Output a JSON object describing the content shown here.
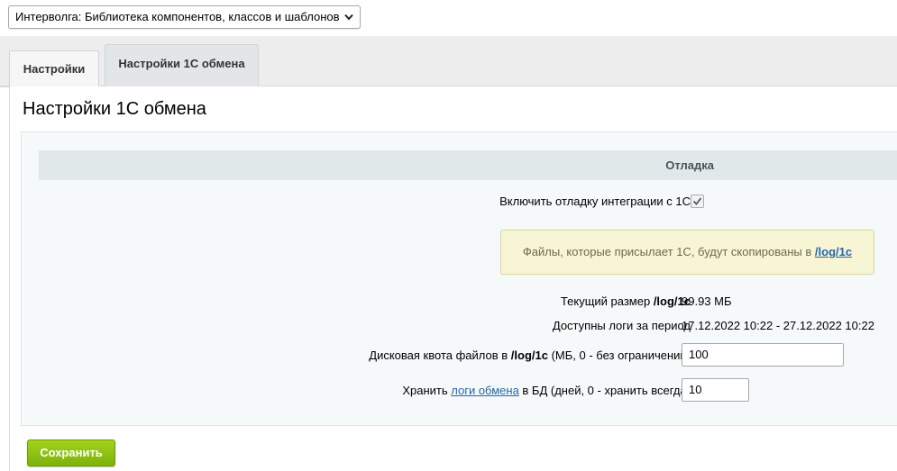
{
  "module_select": {
    "value": "Интерволга: Библиотека компонентов, классов и шаблонов"
  },
  "tabs": [
    {
      "label": "Настройки"
    },
    {
      "label": "Настройки 1С обмена"
    }
  ],
  "page": {
    "title": "Настройки 1С обмена"
  },
  "section": {
    "header": "Отладка"
  },
  "debug": {
    "label": "Включить отладку интеграции с 1С",
    "checked": true
  },
  "note": {
    "text": "Файлы, которые присылает 1С, будут скопированы в ",
    "link": "/log/1c"
  },
  "size": {
    "label_prefix": "Текущий размер ",
    "label_bold": "/log/1c",
    "value": "99.93 МБ"
  },
  "period": {
    "label": "Доступны логи за период",
    "value": "17.12.2022 10:22 - 27.12.2022 10:22"
  },
  "quota": {
    "label_prefix": "Дисковая квота файлов в ",
    "label_bold": "/log/1c",
    "label_suffix": " (МБ, 0 - без ограничений)",
    "value": "100"
  },
  "keep": {
    "label_prefix": "Хранить ",
    "label_link": "логи обмена",
    "label_suffix": " в БД (дней, 0 - хранить всегда)",
    "value": "10"
  },
  "buttons": {
    "save": "Сохранить"
  },
  "icons": {
    "select": "chevron-down-icon",
    "checkbox": "checkmark-icon"
  }
}
